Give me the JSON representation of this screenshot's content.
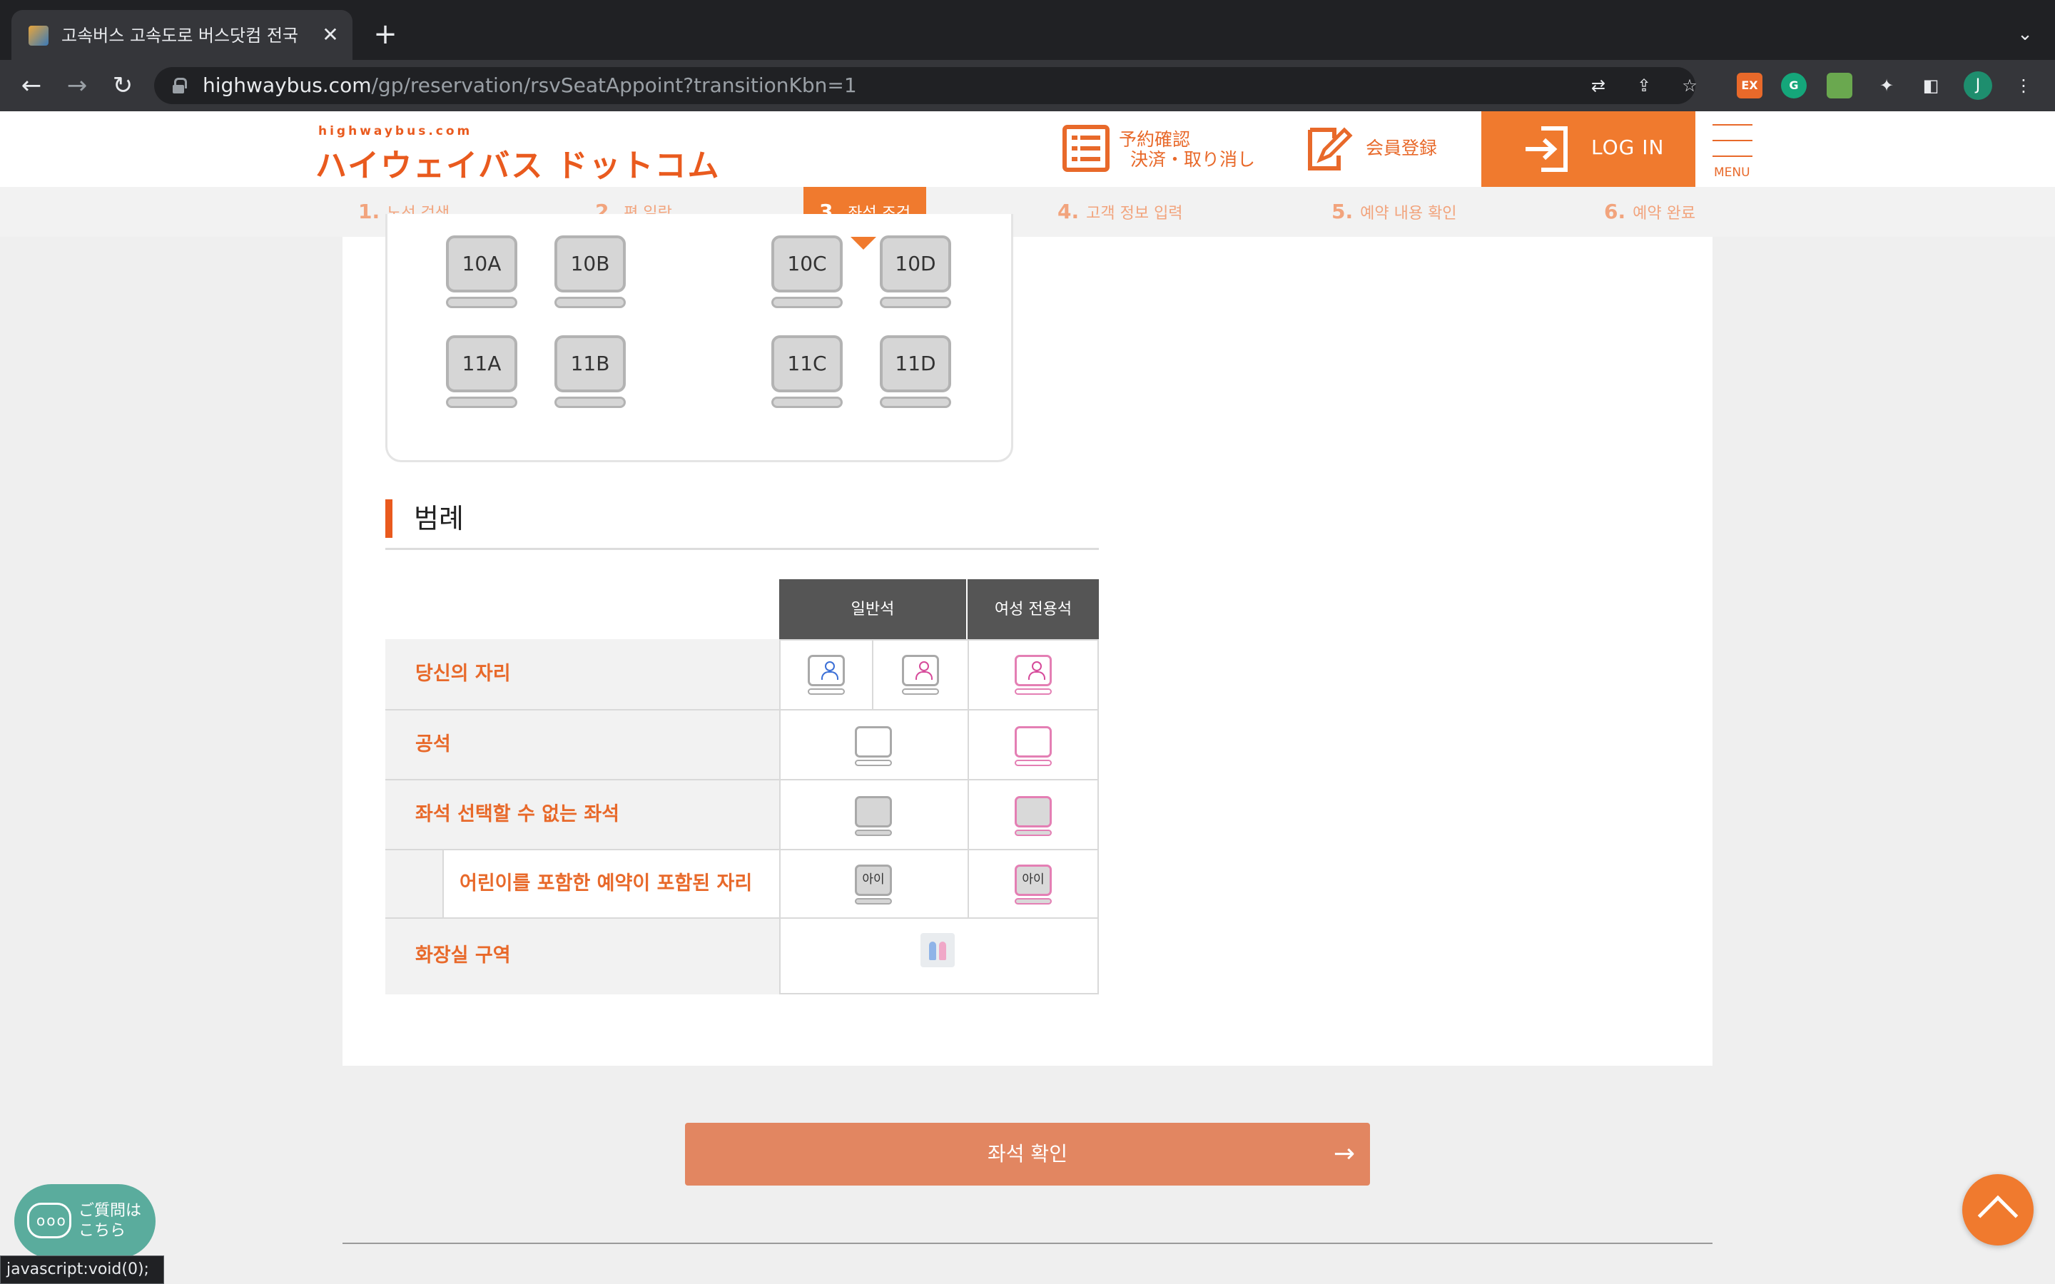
{
  "browser": {
    "tab_title": "고속버스 고속도로 버스닷컴 전국 고속",
    "tab_close": "✕",
    "new_tab": "+",
    "url_host": "highwaybus.com",
    "url_path": "/gp/reservation/rsvSeatAppoint?transitionKbn=1",
    "profile_initial": "J",
    "ext_ex_label": "EX",
    "ext_g_label": "G"
  },
  "header": {
    "logo_small": "highwaybus.com",
    "logo_big": "ハイウェイバス ドットコム",
    "reservation_line1": "予約確認",
    "reservation_line2": "決済・取り消し",
    "member_register": "会員登録",
    "login": "LOG IN",
    "menu": "MENU"
  },
  "steps": [
    {
      "num": "1.",
      "label": "노선 검색"
    },
    {
      "num": "2.",
      "label": "편 일람"
    },
    {
      "num": "3.",
      "label": "좌석 조건"
    },
    {
      "num": "4.",
      "label": "고객 정보 입력"
    },
    {
      "num": "5.",
      "label": "예약 내용 확인"
    },
    {
      "num": "6.",
      "label": "예약 완료"
    }
  ],
  "seats": {
    "row10": [
      "10A",
      "10B",
      "10C",
      "10D"
    ],
    "row11": [
      "11A",
      "11B",
      "11C",
      "11D"
    ]
  },
  "legend": {
    "title": "범례",
    "col_general": "일반석",
    "col_women": "여성 전용석",
    "row_yours": "당신의 자리",
    "row_empty": "공석",
    "row_unavailable": "좌석 선택할 수 없는 좌석",
    "row_child": "어린이를 포함한 예약이 포함된 자리",
    "row_toilet": "화장실 구역",
    "child_mark": "아이"
  },
  "confirm_button": "좌석 확인",
  "confirm_arrow": "→",
  "chat": {
    "line1": "ご質問は",
    "line2": "こちら"
  },
  "status_bar": "javascript:void(0);",
  "colors": {
    "brand_orange": "#f07a2e",
    "confirm_button": "#e28661",
    "women_pink": "#e47fb4",
    "your_seat_blue": "#3b6fd6"
  }
}
